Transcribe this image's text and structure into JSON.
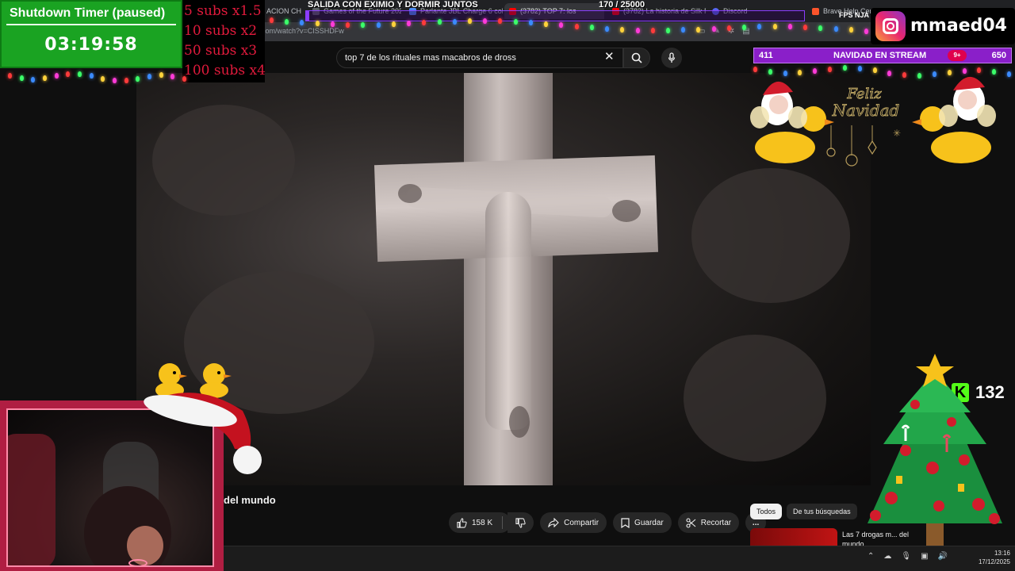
{
  "browser": {
    "tabs": [
      {
        "label": "ACION CH",
        "color": "#5f6368"
      },
      {
        "label": "Games of the Future 2025",
        "color": "#5f6368"
      },
      {
        "label": "Parlante JBL Charge 6 colo",
        "color": "#4c8bf5"
      },
      {
        "label": "(3782) TOP 7: los",
        "color": "#ff0000"
      },
      {
        "label": "(3782) La historia de Silk R",
        "color": "#ff0000"
      },
      {
        "label": "Discord",
        "color": "#5865f2"
      },
      {
        "label": "Brave Help Cente",
        "color": "#fb542b"
      }
    ],
    "url": "com/watch?v=CISSHDFw",
    "fps_label": "FPS NJA"
  },
  "search": {
    "query": "top 7 de los rituales mas macabros de dross"
  },
  "video": {
    "title_fragment": "del mundo",
    "likes": "158 K",
    "share_label": "Compartir",
    "save_label": "Guardar",
    "clip_label": "Recortar",
    "more_label": "..."
  },
  "chips": [
    "Todos",
    "De tus búsquedas"
  ],
  "recommended": {
    "title": "Las 7 drogas m... del mundo"
  },
  "taskbar": {
    "time": "13:16",
    "date": "17/12/2025"
  },
  "overlay": {
    "timer_label": "Shutdown Timer (paused)",
    "timer_value": "03:19:58",
    "subs_multipliers": [
      "5 subs x1.5",
      "10 subs x2",
      "50 subs x3",
      "100 subs x4"
    ],
    "goal_title": "SALIDA CON EXIMIO Y DORMIR JUNTOS",
    "goal_count": "170 / 25000",
    "goal_progress": 0.0068,
    "instagram_handle": "mmaed04",
    "nav_left": "411",
    "nav_title": "NAVIDAD EN STREAM",
    "nav_right": "650",
    "notif_badge": "9+",
    "deco_text": "Feliz Navidad",
    "kick_count": "132"
  },
  "colors": {
    "timer_green": "#1aa322",
    "subs_red": "#e01a3c",
    "goal_purple": "#8a3cff",
    "kick_green": "#53fc18",
    "webcam_frame": "#b01e42"
  }
}
